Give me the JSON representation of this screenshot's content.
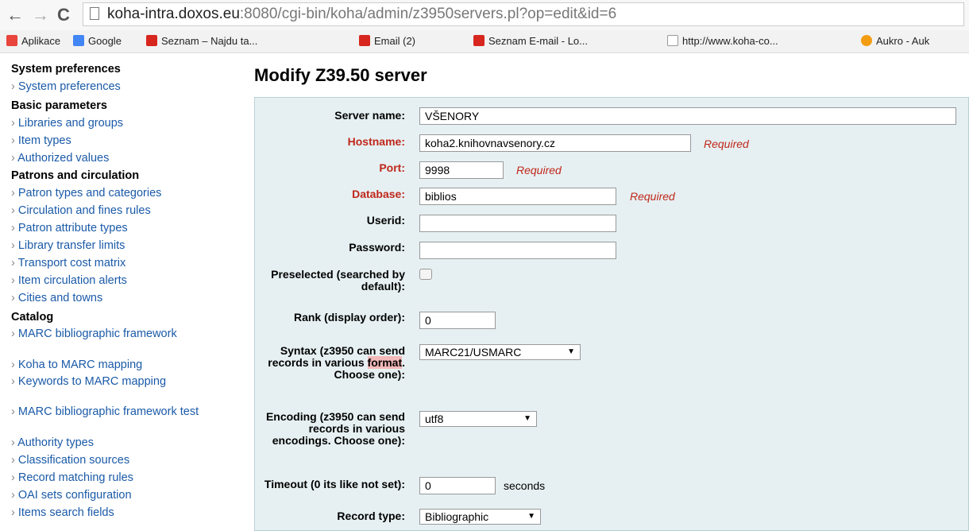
{
  "browser": {
    "url_host": "koha-intra.doxos.eu",
    "url_path": ":8080/cgi-bin/koha/admin/z3950servers.pl?op=edit&id=6",
    "bookmarks": [
      {
        "label": "Aplikace",
        "color": "#e8453c"
      },
      {
        "label": "Google",
        "color": "#4285f4"
      },
      {
        "label": "Seznam – Najdu ta...",
        "color": "#d7261e"
      },
      {
        "label": "Email (2)",
        "color": "#d7261e"
      },
      {
        "label": "Seznam E-mail - Lo...",
        "color": "#d7261e"
      },
      {
        "label": "http://www.koha-co...",
        "color": "#777777"
      },
      {
        "label": "Aukro - Auk",
        "color": "#f39c12"
      }
    ]
  },
  "sidebar": {
    "system_head": "System preferences",
    "system_items": [
      "System preferences"
    ],
    "basic_head": "Basic parameters",
    "basic_items": [
      "Libraries and groups",
      "Item types",
      "Authorized values"
    ],
    "patrons_head": "Patrons and circulation",
    "patrons_items": [
      "Patron types and categories",
      "Circulation and fines rules",
      "Patron attribute types",
      "Library transfer limits",
      "Transport cost matrix",
      "Item circulation alerts",
      "Cities and towns"
    ],
    "catalog_head": "Catalog",
    "catalog_items": [
      "MARC bibliographic framework",
      "Koha to MARC mapping",
      "Keywords to MARC mapping",
      "MARC bibliographic framework test",
      "Authority types",
      "Classification sources",
      "Record matching rules",
      "OAI sets configuration",
      "Items search fields"
    ]
  },
  "main": {
    "title": "Modify Z39.50 server",
    "required_text": "Required",
    "fields": {
      "server_name": {
        "label": "Server name:",
        "value": "VŠENORY"
      },
      "hostname": {
        "label": "Hostname:",
        "value": "koha2.knihovnavsenory.cz"
      },
      "port": {
        "label": "Port:",
        "value": "9998"
      },
      "database": {
        "label": "Database:",
        "value": "biblios"
      },
      "userid": {
        "label": "Userid:",
        "value": ""
      },
      "password": {
        "label": "Password:",
        "value": ""
      },
      "preselected": {
        "label": "Preselected (searched by default):",
        "checked": false
      },
      "rank": {
        "label": "Rank (display order):",
        "value": "0"
      },
      "syntax": {
        "label_a": "Syntax (z3950 can send records in various ",
        "label_hl": "format",
        "label_b": ". Choose one):",
        "value": "MARC21/USMARC"
      },
      "encoding": {
        "label": "Encoding (z3950 can send records in various encodings. Choose one):",
        "value": "utf8"
      },
      "timeout": {
        "label": "Timeout (0 its like not set):",
        "value": "0",
        "suffix": "seconds"
      },
      "record_type": {
        "label": "Record type:",
        "value": "Bibliographic"
      }
    }
  }
}
